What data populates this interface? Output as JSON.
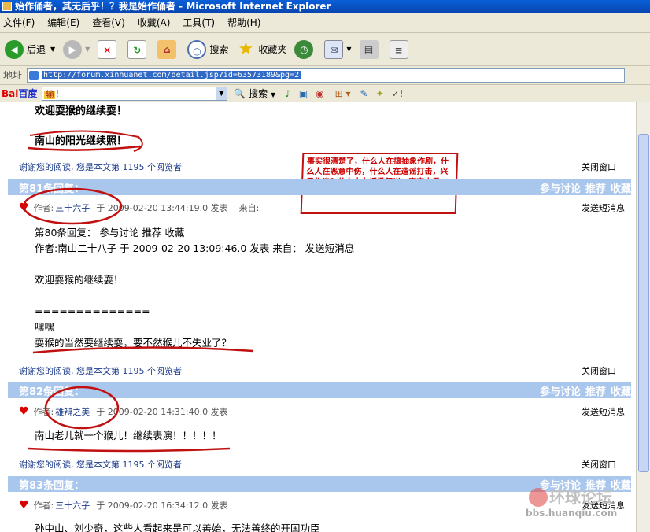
{
  "window": {
    "title": "始作俑者，其无后乎！？我是始作俑者 - Microsoft Internet Explorer"
  },
  "menu": [
    "文件(F)",
    "编辑(E)",
    "查看(V)",
    "收藏(A)",
    "工具(T)",
    "帮助(H)"
  ],
  "toolbar": {
    "back": "后退",
    "search": "搜索",
    "favorites": "收藏夹"
  },
  "address": {
    "label": "地址",
    "url": "http://forum.xinhuanet.com/detail.jsp?id=63573189&pg=2"
  },
  "baidubar": {
    "brand_a": "Bai",
    "brand_b": "百度",
    "query": "!",
    "highlight": "输",
    "search": "搜索"
  },
  "colors": {
    "reply_bar": "#a9c6ec",
    "title_bar": "#0a5fd8",
    "note_border": "#c01010"
  },
  "content": {
    "prev_line1": "欢迎耍猴的继续耍！",
    "prev_line2": "南山的阳光继续照！",
    "thanks_text": "谢谢您的阅读, 您是本文第 1195 个阅览者",
    "close_text": "关闭窗口",
    "note": "事实很清楚了，什么人在搞抽象作剧，什么人在恶意中伤，什么人在造谣打击，兴风作浪？什么人在播撒阳光，宽宏大量",
    "replies": [
      {
        "number": "第81条回复：",
        "actions": [
          "参与讨论",
          "推荐",
          "收藏"
        ],
        "author_label": "作者:",
        "author": "三十六子",
        "at": "于",
        "time": "2009-02-20 13:44:19.0 发表",
        "from": "来自:",
        "message_link": "发送短消息",
        "lines": [
          "第80条回复： 参与讨论 推荐 收藏",
          "作者:南山二十八子 于 2009-02-20 13:09:46.0 发表     来自：   发送短消息",
          "",
          "欢迎耍猴的继续耍！",
          "",
          "==============",
          "嘿嘿",
          "耍猴的当然要继续耍，要不然猴儿不失业了？"
        ]
      },
      {
        "number": "第82条回复：",
        "actions": [
          "参与讨论",
          "推荐",
          "收藏"
        ],
        "author_label": "作者:",
        "author": "雄辩之美",
        "at": "于",
        "time": "2009-02-20 14:31:40.0 发表",
        "from": "来自:",
        "message_link": "发送短消息",
        "lines": [
          "南山老儿就一个猴儿！继续表演！！！！！"
        ]
      },
      {
        "number": "第83条回复：",
        "actions": [
          "参与讨论",
          "推荐",
          "收藏"
        ],
        "author_label": "作者:",
        "author": "三十六子",
        "at": "于",
        "time": "2009-02-20 16:34:12.0 发表",
        "from": "来自:",
        "message_link": "发送短消息",
        "lines": [
          "孙中山、刘少奇，这些人看起来是可以善始，无法善终的开国功臣"
        ]
      }
    ],
    "watermark": {
      "title": "环球论坛",
      "url": "bbs.huanqiu.com"
    }
  }
}
